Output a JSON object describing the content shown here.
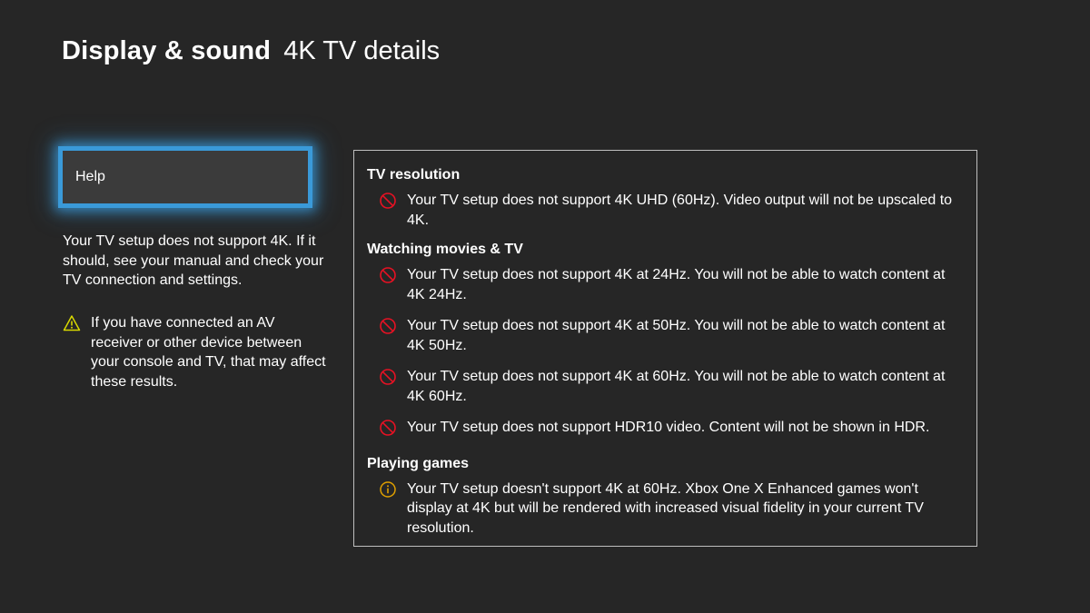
{
  "header": {
    "section_title": "Display & sound",
    "page_title": "4K TV details"
  },
  "sidebar": {
    "help_label": "Help",
    "summary_text": "Your TV setup does not support 4K. If it should, see your manual and check your TV connection and settings.",
    "note_icon": "warning-icon",
    "note_text": "If you have connected an AV receiver or other device between your console and TV, that may affect these results."
  },
  "details": {
    "tv_resolution": {
      "title": "TV resolution",
      "items": [
        {
          "icon": "blocked-icon",
          "text": "Your TV setup does not support 4K UHD (60Hz). Video output will not be upscaled to 4K."
        }
      ]
    },
    "movies_tv": {
      "title": "Watching movies & TV",
      "items": [
        {
          "icon": "blocked-icon",
          "text": "Your TV setup does not support 4K at 24Hz. You will not be able to watch content at 4K 24Hz."
        },
        {
          "icon": "blocked-icon",
          "text": "Your TV setup does not support 4K at 50Hz. You will not be able to watch content at 4K 50Hz."
        },
        {
          "icon": "blocked-icon",
          "text": "Your TV setup does not support 4K at 60Hz. You will not be able to watch content at 4K 60Hz."
        },
        {
          "icon": "blocked-icon",
          "text": "Your TV setup does not support HDR10 video. Content will not be shown in HDR."
        }
      ]
    },
    "games": {
      "title": "Playing games",
      "items": [
        {
          "icon": "info-icon",
          "text": "Your TV setup doesn't support 4K at 60Hz. Xbox One X Enhanced games won't display at 4K but will be rendered with increased visual fidelity in your current TV resolution."
        }
      ]
    }
  },
  "colors": {
    "background": "#262626",
    "focus_accent": "#3a9ad9",
    "blocked": "#e81123",
    "warning": "#d8d800",
    "info": "#e0a000"
  }
}
